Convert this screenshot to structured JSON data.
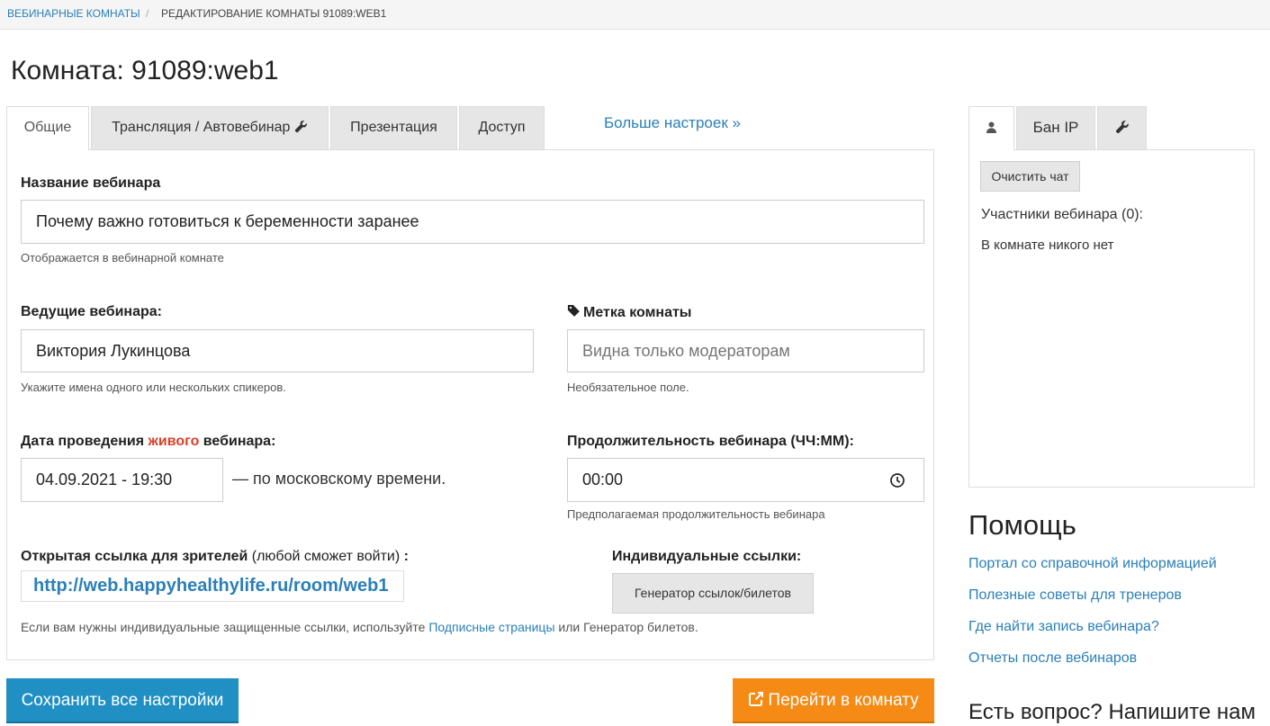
{
  "breadcrumb": {
    "parent": "Вебинарные комнаты",
    "separator": "/",
    "current": "Редактирование комнаты 91089:web1"
  },
  "page_title": "Комната: 91089:web1",
  "tabs": [
    {
      "label": "Общие",
      "active": true
    },
    {
      "label": "Трансляция / Автовебинар",
      "icon": "wrench-icon"
    },
    {
      "label": "Презентация"
    },
    {
      "label": "Доступ"
    }
  ],
  "tabs_more": "Больше настроек »",
  "form": {
    "webinar_name": {
      "label": "Название вебинара",
      "value": "Почему важно готовиться к беременности заранее",
      "help": "Отображается в вебинарной комнате"
    },
    "hosts": {
      "label": "Ведущие вебинара:",
      "value": "Виктория Лукинцова",
      "help": "Укажите имена одного или нескольких спикеров."
    },
    "room_tag": {
      "icon": "tag-icon",
      "label": "Метка комнаты",
      "placeholder": "Видна только модераторам",
      "help": "Необязательное поле."
    },
    "date": {
      "label_before": "Дата проведения ",
      "label_highlight": "живого",
      "label_after": " вебинара:",
      "value": "04.09.2021 - 19:30",
      "suffix": "— по московскому времени."
    },
    "duration": {
      "label": "Продолжительность вебинара (ЧЧ:ММ):",
      "value": "00:00",
      "icon": "clock-icon",
      "help": "Предполагаемая продолжительность вебинара"
    },
    "open_link": {
      "label_bold": "Открытая ссылка для зрителей",
      "label_normal": " (любой сможет войти) ",
      "label_colon": ":",
      "value": "http://web.happyhealthylife.ru/room/web1"
    },
    "individual_links": {
      "label": "Индивидуальные ссылки:",
      "button": "Генератор ссылок/билетов"
    },
    "note": {
      "before": "Если вам нужны индивидуальные защищенные ссылки, используйте ",
      "link": "Подписные страницы",
      "after": " или Генератор билетов."
    }
  },
  "actions": {
    "save": "Сохранить все настройки",
    "go": "Перейти в комнату",
    "go_icon": "external-link-icon"
  },
  "sidebar": {
    "tabs": [
      {
        "icon": "user-icon",
        "active": true
      },
      {
        "label": "Бан IP"
      },
      {
        "icon": "wrench-icon"
      }
    ],
    "clear_chat": "Очистить чат",
    "participants": "Участники вебинара (0):",
    "empty": "В комнате никого нет"
  },
  "help": {
    "title": "Помощь",
    "links": [
      "Портал со справочной информацией",
      "Полезные советы для тренеров",
      "Где найти запись вебинара?",
      "Отчеты после вебинаров"
    ]
  },
  "ask": "Есть вопрос? Напишите нам",
  "colors": {
    "link": "#2a7fb8",
    "save_button": "#1f8fc4",
    "go_button": "#f58a14",
    "highlight": "#d9412a"
  }
}
